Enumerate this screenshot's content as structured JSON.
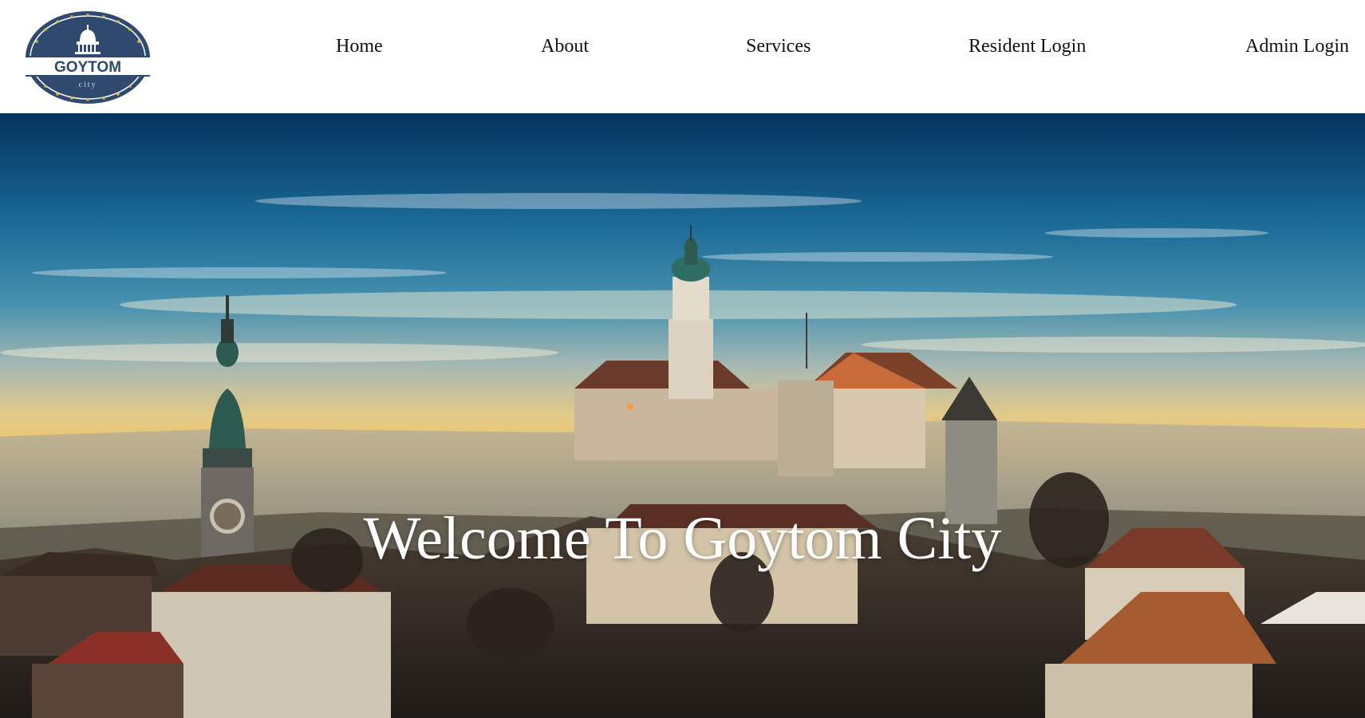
{
  "brand": {
    "logo_main": "GOYTOM",
    "logo_sub": "city"
  },
  "nav": {
    "items": [
      {
        "label": "Home"
      },
      {
        "label": "About"
      },
      {
        "label": "Services"
      },
      {
        "label": "Resident Login"
      },
      {
        "label": "Admin Login"
      }
    ]
  },
  "hero": {
    "title": "Welcome To Goytom City"
  },
  "colors": {
    "logo_navy": "#2f4a6e",
    "nav_text": "#111111",
    "hero_text": "#ffffff"
  },
  "icons": {
    "logo": "city-capitol-emblem"
  }
}
